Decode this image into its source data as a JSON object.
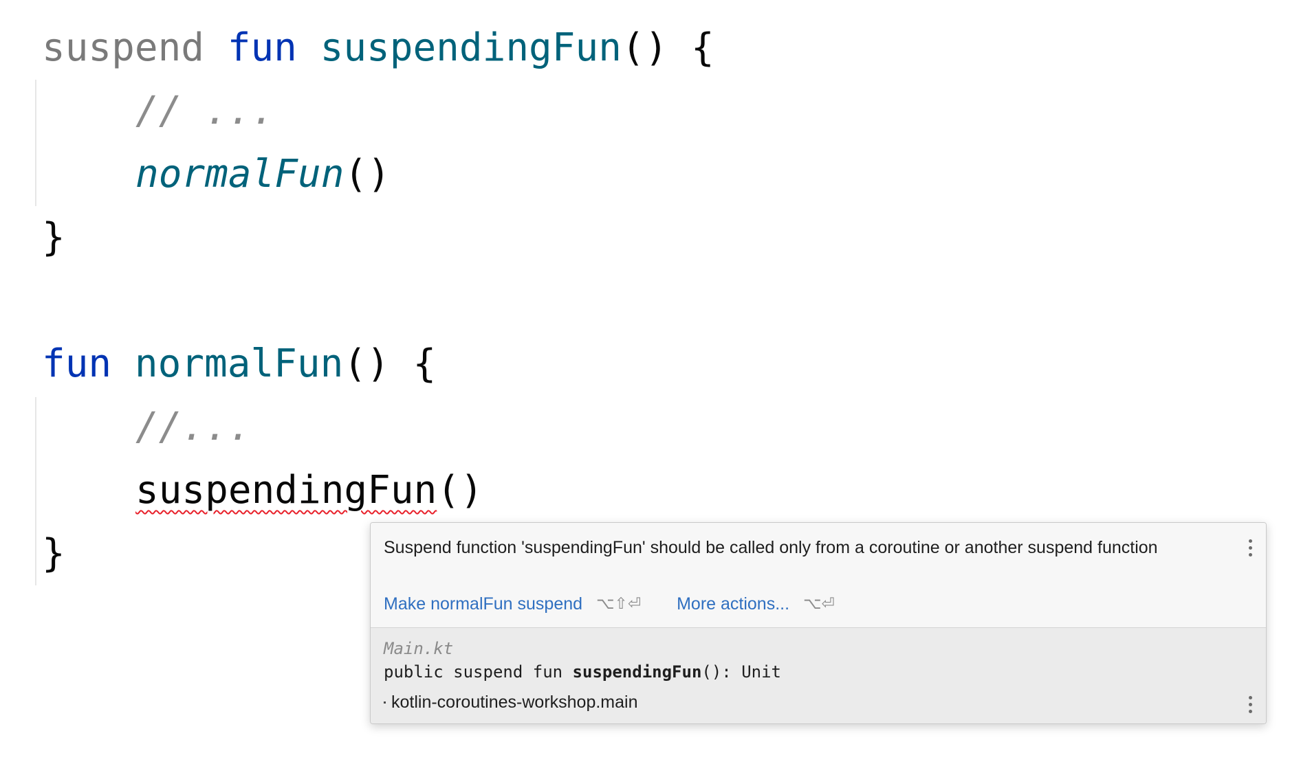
{
  "editor": {
    "line1": {
      "modifier": "suspend",
      "keyword": "fun",
      "name": "suspendingFun",
      "rest": "() {"
    },
    "line2": {
      "comment": "// ..."
    },
    "line3": {
      "call": "normalFun",
      "rest": "()"
    },
    "line4": {
      "text": "}"
    },
    "line5": {
      "keyword": "fun",
      "name": "normalFun",
      "rest": "() {"
    },
    "line6": {
      "comment": "//..."
    },
    "line7": {
      "call": "suspendingFun",
      "rest": "()"
    },
    "line8": {
      "text": "}"
    }
  },
  "popup": {
    "message": "Suspend function 'suspendingFun' should be called only from a coroutine or another suspend function",
    "actions": {
      "primary_label": "Make normalFun suspend",
      "primary_shortcut": "⌥⇧⏎",
      "more_label": "More actions...",
      "more_shortcut": "⌥⏎"
    },
    "doc": {
      "file": "Main.kt",
      "sig_prefix": "public suspend fun ",
      "sig_name": "suspendingFun",
      "sig_suffix": "(): Unit",
      "module": "kotlin-coroutines-workshop.main"
    },
    "colors": {
      "link": "#2f6fc0",
      "error_underline": "#e8202a"
    }
  }
}
